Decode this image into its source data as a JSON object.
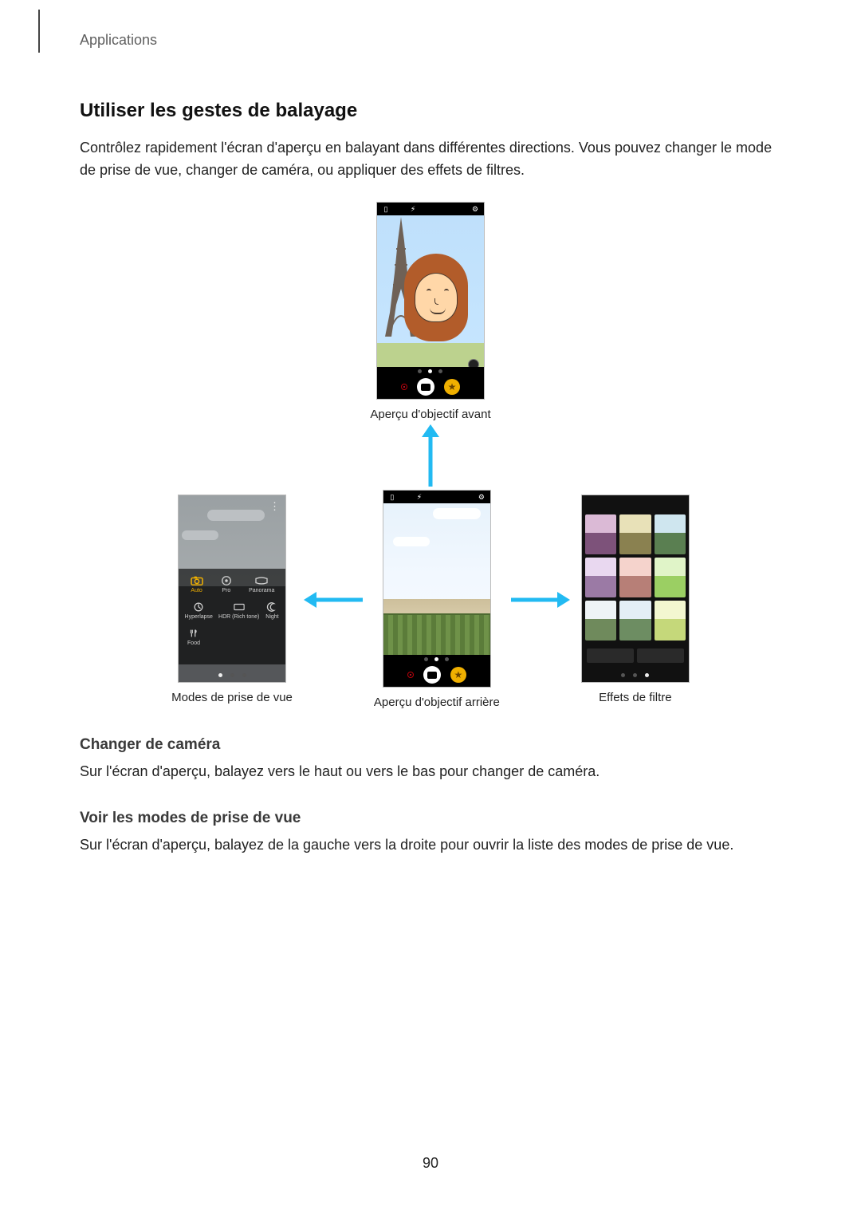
{
  "header": {
    "section": "Applications"
  },
  "title": "Utiliser les gestes de balayage",
  "intro": "Contrôlez rapidement l'écran d'aperçu en balayant dans différentes directions. Vous pouvez changer le mode de prise de vue, changer de caméra, ou appliquer des effets de filtres.",
  "captions": {
    "front_preview": "Aperçu d'objectif avant",
    "modes": "Modes de prise de vue",
    "rear_preview": "Aperçu d'objectif arrière",
    "filters": "Effets de filtre"
  },
  "modes_panel": {
    "row1": [
      {
        "icon": "camera",
        "label": "Auto",
        "active": true
      },
      {
        "icon": "pro",
        "label": "Pro",
        "active": false
      },
      {
        "icon": "panorama",
        "label": "Panorama",
        "active": false
      }
    ],
    "row2": [
      {
        "icon": "hyperlapse",
        "label": "Hyperlapse",
        "active": false
      },
      {
        "icon": "hdr",
        "label": "HDR (Rich tone)",
        "active": false
      },
      {
        "icon": "night",
        "label": "Night",
        "active": false
      }
    ],
    "row3": [
      {
        "icon": "food",
        "label": "Food",
        "active": false
      }
    ]
  },
  "sections": [
    {
      "heading": "Changer de caméra",
      "body": "Sur l'écran d'aperçu, balayez vers le haut ou vers le bas pour changer de caméra."
    },
    {
      "heading": "Voir les modes de prise de vue",
      "body": "Sur l'écran d'aperçu, balayez de la gauche vers la droite pour ouvrir la liste des modes de prise de vue."
    }
  ],
  "page_number": "90"
}
